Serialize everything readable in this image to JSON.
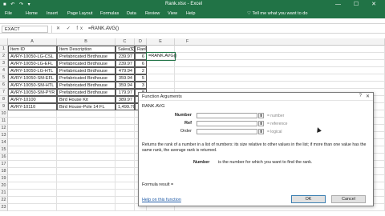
{
  "titlebar": {
    "quick_access": "■ ↶ ↷ ▾",
    "title": "Rank.xlsx - Excel",
    "window_controls": "— ☐ ✕"
  },
  "ribbon": {
    "tabs": [
      "File",
      "Home",
      "Insert",
      "Page Layout",
      "Formulas",
      "Data",
      "Review",
      "View",
      "Help"
    ],
    "tell_me": "♡ Tell me what you want to do"
  },
  "formula_bar": {
    "name_box": "EXACT",
    "fx": "✕ ✓ fx",
    "formula": "=RANK.AVG()"
  },
  "grid": {
    "columns": [
      "A",
      "B",
      "C",
      "D",
      "E",
      "F"
    ],
    "rows": [
      "1",
      "2",
      "3",
      "4",
      "5",
      "6",
      "7",
      "8",
      "9",
      "10",
      "11",
      "12",
      "13",
      "14",
      "15",
      "16",
      "17",
      "18",
      "19",
      "20",
      "21",
      "22",
      "23"
    ],
    "headers": [
      "Item ID",
      "Item Description",
      "Sales($)",
      "Rank"
    ],
    "data": [
      [
        "AVRY-10050-LG-CSL",
        "Prefabricated Birdhouse",
        "239.97",
        "6"
      ],
      [
        "AVRY-10050-LG-EFL",
        "Prefabricated Birdhouse",
        "239.97",
        "6"
      ],
      [
        "AVRY-10050-LG-HTL",
        "Prefabricated Birdhouse",
        "479.94",
        "2"
      ],
      [
        "AVRY-10050-SM-EFL",
        "Prefabricated Birdhouse",
        "359.94",
        "5"
      ],
      [
        "AVRY-10050-SM-HTL",
        "Prefabricated Birdhouse",
        "359.94",
        "3"
      ],
      [
        "AVRY-10050-SM-PYR",
        "Prefabricated Birdhouse",
        "179.97",
        "8"
      ],
      [
        "AVRY-10100",
        "Bird House Kit",
        "389.97",
        ""
      ],
      [
        "AVRY-10110",
        "Bird House-Pole 14 FL",
        "1,499.70",
        ""
      ]
    ],
    "active_cell": "=RANK.AVG()"
  },
  "dialog": {
    "title": "Function Arguments",
    "help_glyph": "?",
    "close_glyph": "✕",
    "function_name": "RANK.AVG",
    "args": [
      {
        "label": "Number",
        "bold": true,
        "hint": "= number"
      },
      {
        "label": "Ref",
        "bold": true,
        "hint": "= reference"
      },
      {
        "label": "Order",
        "bold": false,
        "hint": "= logical"
      }
    ],
    "picker_glyph": "⬆",
    "description": "Returns the rank of a number in a list of numbers: its size relative to other values in the list; if more than one value has the same rank, the average rank is returned.",
    "param_label": "Number",
    "param_description": "is the number for which you want to find the rank.",
    "formula_result": "Formula result =",
    "help_link": "Help on this function",
    "ok": "OK",
    "cancel": "Cancel"
  },
  "colors": {
    "excel_green": "#217346",
    "link_blue": "#1f5aa6"
  }
}
